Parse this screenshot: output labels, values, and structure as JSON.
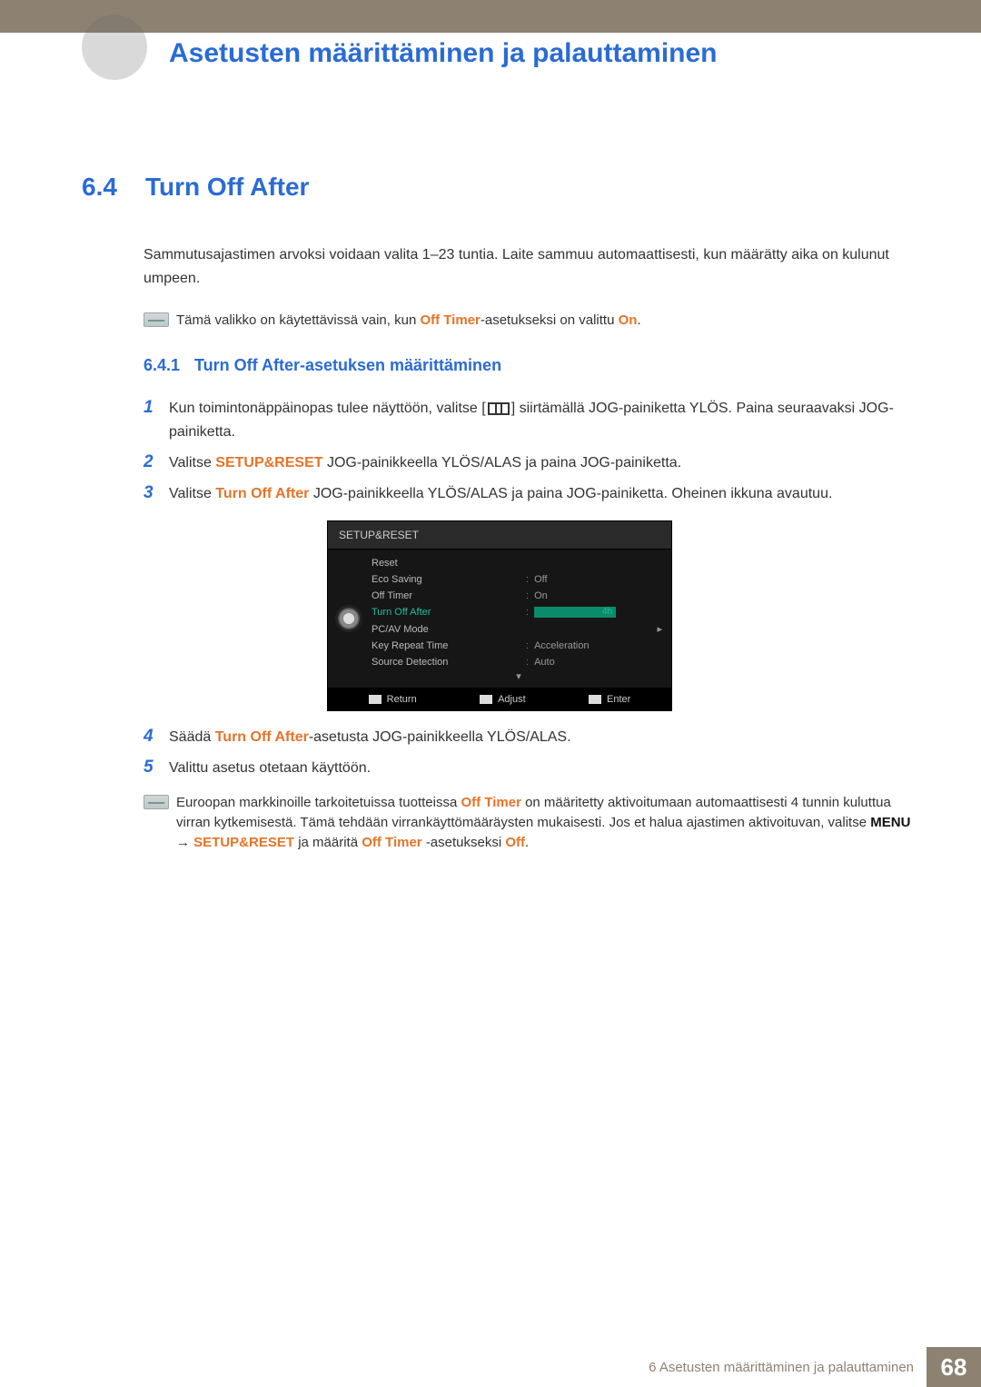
{
  "header": {
    "chapter_title": "Asetusten määrittäminen ja palauttaminen"
  },
  "section": {
    "number": "6.4",
    "title": "Turn Off After",
    "intro": "Sammutusajastimen arvoksi voidaan valita 1–23 tuntia. Laite sammuu automaattisesti, kun määrätty aika on kulunut umpeen."
  },
  "note1": {
    "pre": "Tämä valikko on käytettävissä vain, kun ",
    "b1": "Off Timer",
    "mid": "-asetukseksi on valittu ",
    "b2": "On",
    "post": "."
  },
  "subsection": {
    "number": "6.4.1",
    "title": "Turn Off After-asetuksen määrittäminen"
  },
  "steps": {
    "s1a": "Kun toimintonäppäinopas tulee näyttöön, valitse [",
    "s1b": "] siirtämällä JOG-painiketta YLÖS. Paina seuraavaksi JOG-painiketta.",
    "s2a": "Valitse ",
    "s2b": "SETUP&RESET",
    "s2c": " JOG-painikkeella YLÖS/ALAS ja paina JOG-painiketta.",
    "s3a": "Valitse ",
    "s3b": "Turn Off After",
    "s3c": " JOG-painikkeella YLÖS/ALAS ja paina JOG-painiketta. Oheinen ikkuna avautuu.",
    "s4a": "Säädä ",
    "s4b": "Turn Off After",
    "s4c": "-asetusta JOG-painikkeella YLÖS/ALAS.",
    "s5": "Valittu asetus otetaan käyttöön.",
    "n1": "1",
    "n2": "2",
    "n3": "3",
    "n4": "4",
    "n5": "5"
  },
  "osd": {
    "title": "SETUP&RESET",
    "items": [
      {
        "label": "Reset",
        "value": ""
      },
      {
        "label": "Eco Saving",
        "value": "Off"
      },
      {
        "label": "Off Timer",
        "value": "On"
      },
      {
        "label": "Turn Off After",
        "value": "4h",
        "active": true
      },
      {
        "label": "PC/AV Mode",
        "value": ""
      },
      {
        "label": "Key Repeat Time",
        "value": "Acceleration"
      },
      {
        "label": "Source Detection",
        "value": "Auto"
      }
    ],
    "footer": {
      "return": "Return",
      "adjust": "Adjust",
      "enter": "Enter"
    }
  },
  "note2": {
    "a": "Euroopan markkinoille tarkoitetuissa tuotteissa ",
    "b": "Off Timer",
    "c": " on määritetty aktivoitumaan automaattisesti 4 tunnin kuluttua virran kytkemisestä. Tämä tehdään virrankäyttömääräysten mukaisesti. Jos et halua ajastimen aktivoituvan, valitse ",
    "d": "MENU",
    "arrow": " → ",
    "e": "SETUP&RESET",
    "f": " ja määritä ",
    "g": "Off Timer",
    "h": " -asetukseksi ",
    "i": "Off",
    "j": "."
  },
  "footer": {
    "chapter": "6 Asetusten määrittäminen ja palauttaminen",
    "page": "68"
  }
}
